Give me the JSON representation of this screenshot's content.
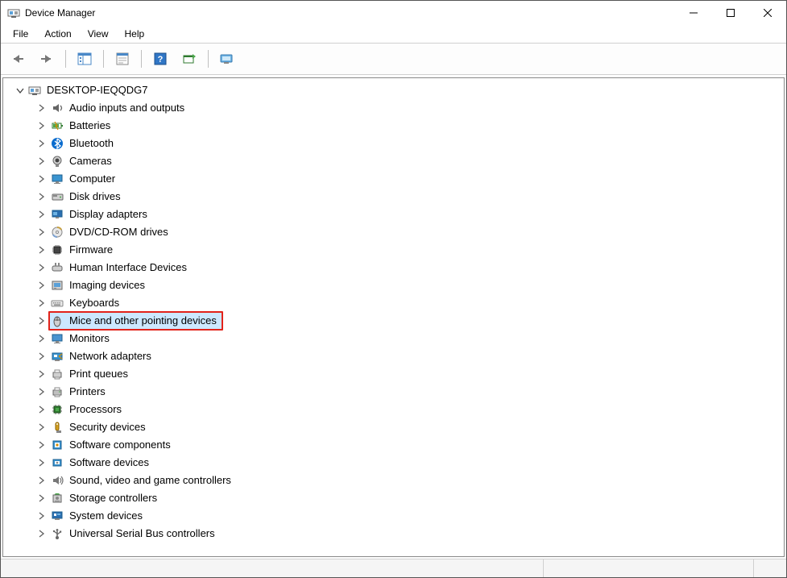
{
  "title": "Device Manager",
  "menu": [
    "File",
    "Action",
    "View",
    "Help"
  ],
  "computer_name": "DESKTOP-IEQQDG7",
  "categories": [
    {
      "label": "Audio inputs and outputs",
      "icon": "speaker"
    },
    {
      "label": "Batteries",
      "icon": "battery"
    },
    {
      "label": "Bluetooth",
      "icon": "bluetooth"
    },
    {
      "label": "Cameras",
      "icon": "camera"
    },
    {
      "label": "Computer",
      "icon": "monitor"
    },
    {
      "label": "Disk drives",
      "icon": "disk"
    },
    {
      "label": "Display adapters",
      "icon": "display"
    },
    {
      "label": "DVD/CD-ROM drives",
      "icon": "cd"
    },
    {
      "label": "Firmware",
      "icon": "chip"
    },
    {
      "label": "Human Interface Devices",
      "icon": "hid"
    },
    {
      "label": "Imaging devices",
      "icon": "imaging"
    },
    {
      "label": "Keyboards",
      "icon": "keyboard"
    },
    {
      "label": "Mice and other pointing devices",
      "icon": "mouse",
      "highlighted": true
    },
    {
      "label": "Monitors",
      "icon": "monitor2"
    },
    {
      "label": "Network adapters",
      "icon": "network"
    },
    {
      "label": "Print queues",
      "icon": "printqueue"
    },
    {
      "label": "Printers",
      "icon": "printer"
    },
    {
      "label": "Processors",
      "icon": "cpu"
    },
    {
      "label": "Security devices",
      "icon": "security"
    },
    {
      "label": "Software components",
      "icon": "swcomp"
    },
    {
      "label": "Software devices",
      "icon": "swdev"
    },
    {
      "label": "Sound, video and game controllers",
      "icon": "sound"
    },
    {
      "label": "Storage controllers",
      "icon": "storage"
    },
    {
      "label": "System devices",
      "icon": "system"
    },
    {
      "label": "Universal Serial Bus controllers",
      "icon": "usb"
    }
  ]
}
